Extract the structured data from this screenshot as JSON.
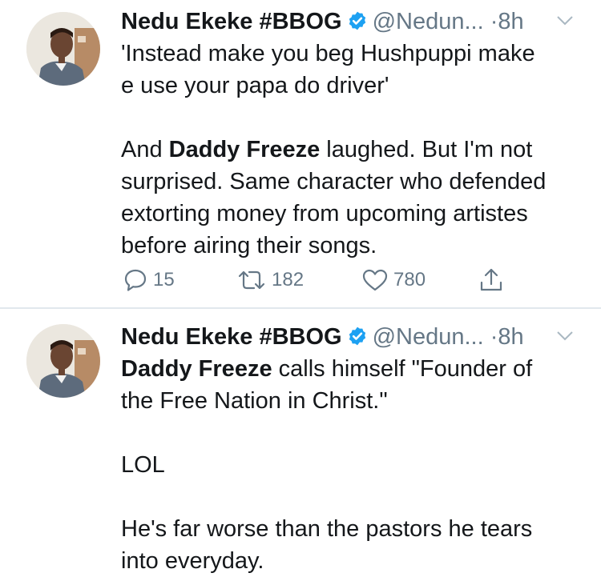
{
  "colors": {
    "text": "#14171a",
    "muted": "#657786",
    "verified": "#1da1f2",
    "divider": "#e1e8ed"
  },
  "tweets": [
    {
      "author": {
        "name": "Nedu Ekeke #BBOG",
        "handle": "@Nedun...",
        "separator": "·",
        "time": "8h",
        "avatar_icon": "profile-photo",
        "verified_icon": "verified-badge-icon"
      },
      "lines": [
        {
          "segments": [
            {
              "text": "'Instead make you beg Hushpuppi make",
              "bold": false
            }
          ]
        },
        {
          "segments": [
            {
              "text": "e use your papa do driver'",
              "bold": false
            }
          ]
        },
        {
          "blank": true
        },
        {
          "segments": [
            {
              "text": "And ",
              "bold": false
            },
            {
              "text": "Daddy Freeze",
              "bold": true
            },
            {
              "text": " laughed. But I'm not",
              "bold": false
            }
          ]
        },
        {
          "segments": [
            {
              "text": "surprised. Same character who defended",
              "bold": false
            }
          ]
        },
        {
          "segments": [
            {
              "text": "extorting money from upcoming artistes",
              "bold": false
            }
          ]
        },
        {
          "segments": [
            {
              "text": "before airing their songs.",
              "bold": false
            }
          ]
        }
      ],
      "actions": {
        "replies": "15",
        "retweets": "182",
        "likes": "780",
        "icons": [
          "reply-icon",
          "retweet-icon",
          "like-icon",
          "share-icon"
        ]
      }
    },
    {
      "author": {
        "name": "Nedu Ekeke #BBOG",
        "handle": "@Nedun...",
        "separator": "·",
        "time": "8h",
        "avatar_icon": "profile-photo",
        "verified_icon": "verified-badge-icon"
      },
      "lines": [
        {
          "segments": [
            {
              "text": "Daddy Freeze",
              "bold": true
            },
            {
              "text": " calls himself \"Founder of",
              "bold": false
            }
          ]
        },
        {
          "segments": [
            {
              "text": "the Free Nation in Christ.\"",
              "bold": false
            }
          ]
        },
        {
          "blank": true
        },
        {
          "segments": [
            {
              "text": "LOL",
              "bold": false
            }
          ]
        },
        {
          "blank": true
        },
        {
          "segments": [
            {
              "text": "He's far worse than the pastors he tears",
              "bold": false
            }
          ]
        },
        {
          "segments": [
            {
              "text": "into everyday.",
              "bold": false
            }
          ]
        }
      ]
    }
  ]
}
